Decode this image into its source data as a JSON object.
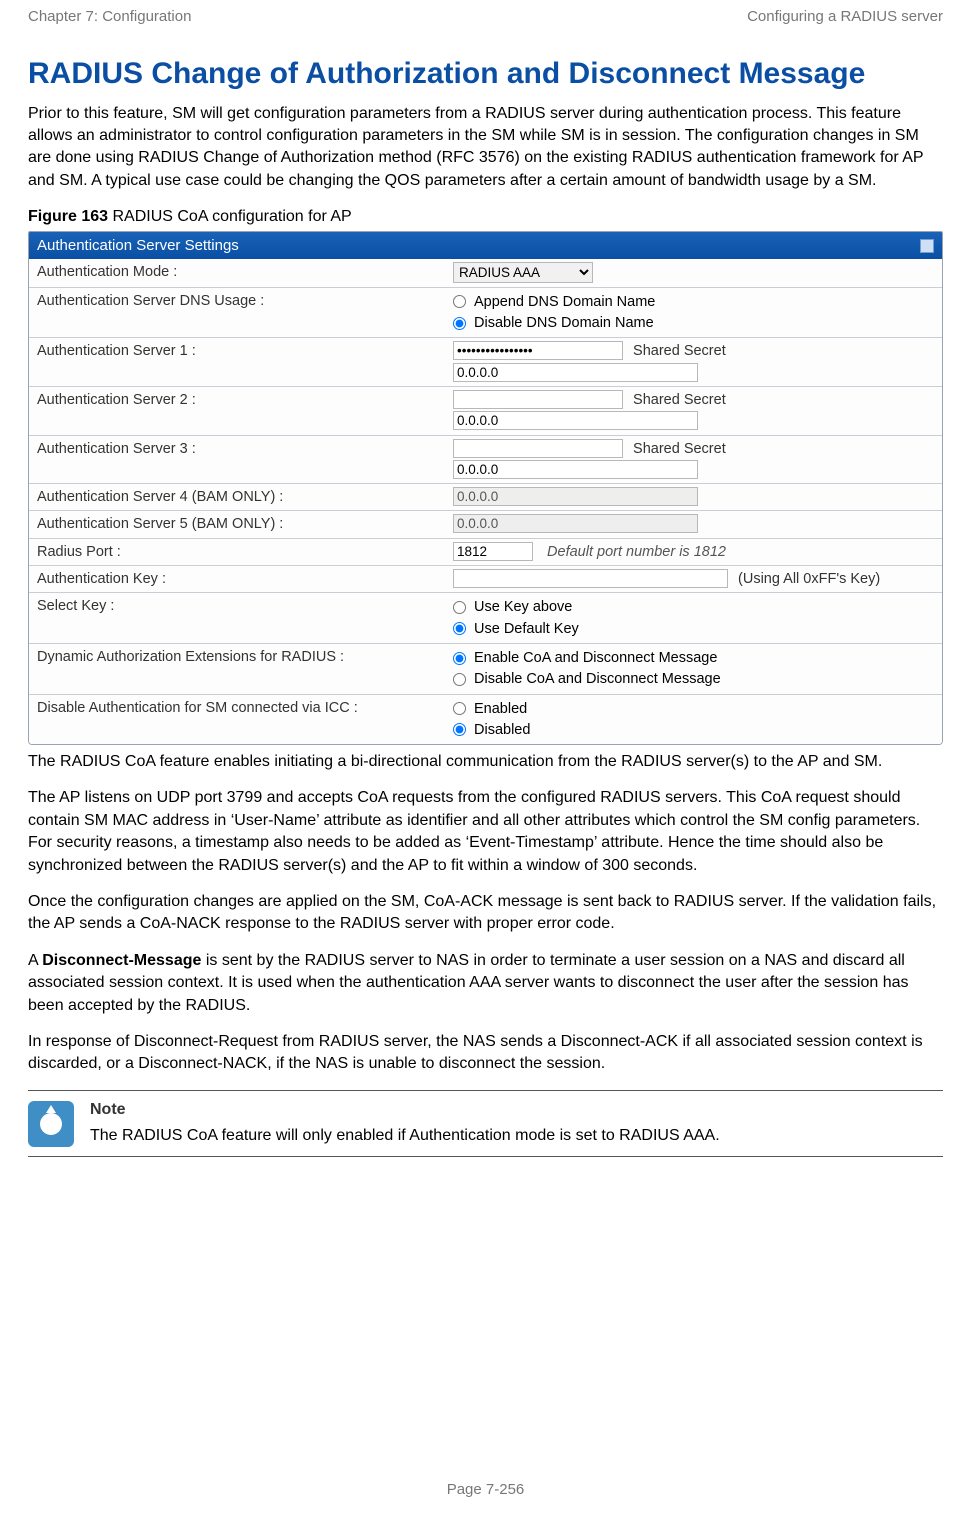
{
  "header": {
    "left": "Chapter 7:  Configuration",
    "right": "Configuring a RADIUS server"
  },
  "title": "RADIUS Change of Authorization and Disconnect Message",
  "intro": "Prior to this feature, SM will get configuration parameters from a RADIUS server during authentication process. This feature allows an administrator to control configuration parameters in the SM while SM is in session. The configuration changes in SM are done using RADIUS Change of Authorization method (RFC 3576) on the existing RADIUS authentication framework for AP and SM. A typical use case could be changing the QOS parameters after a certain amount of bandwidth usage by a SM.",
  "figure": {
    "label": "Figure 163",
    "caption": " RADIUS CoA configuration for AP",
    "panel_title": "Authentication Server Settings",
    "rows": {
      "auth_mode_label": "Authentication Mode :",
      "auth_mode_value": "RADIUS AAA",
      "dns_usage_label": "Authentication Server DNS Usage :",
      "dns_opt1": "Append DNS Domain Name",
      "dns_opt2": "Disable DNS Domain Name",
      "as1_label": "Authentication Server 1 :",
      "as1_secret": "••••••••••••••••",
      "ss_text": "Shared Secret",
      "ip_zero": "0.0.0.0",
      "as2_label": "Authentication Server 2 :",
      "as3_label": "Authentication Server 3 :",
      "as4_label": "Authentication Server 4 (BAM ONLY) :",
      "as5_label": "Authentication Server 5 (BAM ONLY) :",
      "radius_port_label": "Radius Port :",
      "radius_port_value": "1812",
      "radius_port_hint": "Default port number is 1812",
      "auth_key_label": "Authentication Key :",
      "auth_key_aux": "(Using All 0xFF's Key)",
      "select_key_label": "Select Key :",
      "select_key_opt1": "Use Key above",
      "select_key_opt2": "Use Default Key",
      "dae_label": "Dynamic Authorization Extensions for RADIUS :",
      "dae_opt1": "Enable CoA and Disconnect Message",
      "dae_opt2": "Disable CoA and Disconnect Message",
      "disauth_label": "Disable Authentication for SM connected via ICC :",
      "disauth_opt1": "Enabled",
      "disauth_opt2": "Disabled"
    }
  },
  "para1": "The RADIUS CoA feature enables initiating a bi-directional communication from the RADIUS server(s) to the AP and SM.",
  "para2": "The AP listens on UDP port 3799 and accepts CoA requests from the configured RADIUS servers. This CoA request should contain SM MAC address in ‘User-Name’ attribute as identifier and all other attributes which control the SM config parameters. For security reasons, a timestamp also needs to be added as ‘Event-Timestamp’ attribute. Hence the time should also be synchronized between the RADIUS server(s) and the AP to fit within a window of 300 seconds.",
  "para3": "Once the configuration changes are applied on the SM, CoA-ACK message is sent back to RADIUS server. If the validation fails, the AP sends a CoA-NACK response to the RADIUS server with proper error code.",
  "para4_pre": "A ",
  "para4_bold": "Disconnect-Message",
  "para4_post": " is sent by the RADIUS server to NAS in order to terminate a user session on a NAS and discard all associated session context. It is used when the authentication AAA server wants to disconnect the user after the session has been accepted by the RADIUS.",
  "para5": "In response of Disconnect-Request from RADIUS server, the NAS sends a Disconnect-ACK if all associated session context is discarded, or a Disconnect-NACK, if the NAS is unable to disconnect the session.",
  "note": {
    "title": "Note",
    "text": "The RADIUS CoA feature will only enabled if Authentication mode is set to RADIUS AAA."
  },
  "footer": "Page 7-256"
}
